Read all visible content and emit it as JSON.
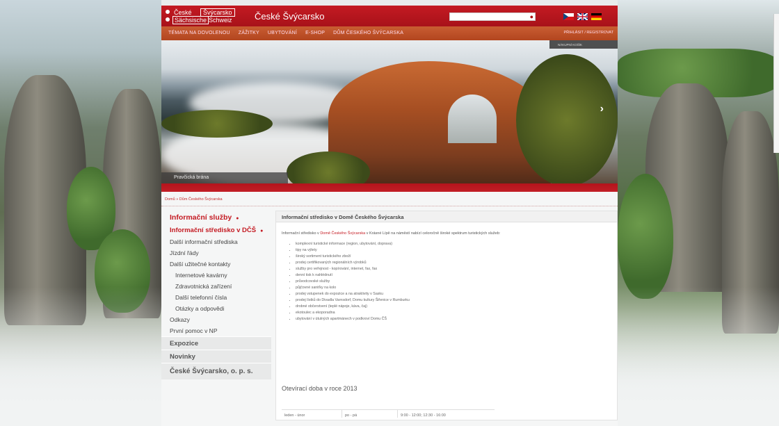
{
  "header": {
    "logo": {
      "line1a": "České",
      "line1b": "Švýcarsko",
      "line2a": "Sächsische",
      "line2b": "Schweiz"
    },
    "site_title": "České Švýcarsko",
    "search_placeholder": "",
    "languages": [
      "cz-flag-icon",
      "uk-flag-icon",
      "de-flag-icon"
    ]
  },
  "menu": {
    "items": [
      "TÉMATA NA DOVOLENOU",
      "ZÁŽITKY",
      "UBYTOVÁNÍ",
      "E-SHOP",
      "DŮM ČESKÉHO ŠVÝCARSKA"
    ],
    "login": "PŘIHLÁSIT / REGISTROVAT"
  },
  "hero": {
    "caption": "Pravčická brána",
    "cart": "NÁKUPNÍ KOŠÍK"
  },
  "breadcrumb": "Domů » Dům Českého Švýcarska",
  "sidebar": {
    "section1": "Informační služby",
    "active": "Informační středisko v DČŠ",
    "items": [
      "Další informační střediska",
      "Jízdní řády",
      "Další užitečné kontakty"
    ],
    "subitems": [
      "Internetové kavárny",
      "Zdravotnická zařízení",
      "Další telefonní čísla",
      "Otázky a odpovědi"
    ],
    "items2": [
      "Odkazy",
      "První pomoc v NP"
    ],
    "sections": [
      "Expozice",
      "Novinky",
      "České Švýcarsko, o. p. s."
    ]
  },
  "content": {
    "title": "Informační středisko v Domě Českého Švýcarska",
    "intro_a": "Informační středisko v ",
    "intro_link": "Domě Českého Švýcarska",
    "intro_b": " v Krásné Lípě na náměstí nabízí celoročně široké spektrum turistických služeb:",
    "services": [
      "komplexní turistické informace (region, ubytování, doprava)",
      "tipy na výlety",
      "široký sortiment turistického zboží",
      "prodej certifikovaných regionálních výrobků",
      "služby pro veřejnost - kopírování, internet, fax, fax",
      "denní tisk k nahlédnutí",
      "průvodcovské služby",
      "půjčovné saniťky na kolo",
      "prodej vstupenek do expozice a na atraktivity v Sasku",
      "prodej lístků do Divadla Varnsdorf, Domu kultury Šiřenice v Rumburku",
      "drobné občerstvení (teplé nápoje, káva, čaj)",
      "ekotoulec a ekoporadna",
      "ubytování v útulných apartmánech v podkroví Domu ČŠ"
    ],
    "hours_title": "Otevírací doba v roce 2013",
    "hours_row": [
      "leden - únor",
      "po - pá",
      "9:00 - 12:00; 12:30 - 16:00"
    ]
  }
}
